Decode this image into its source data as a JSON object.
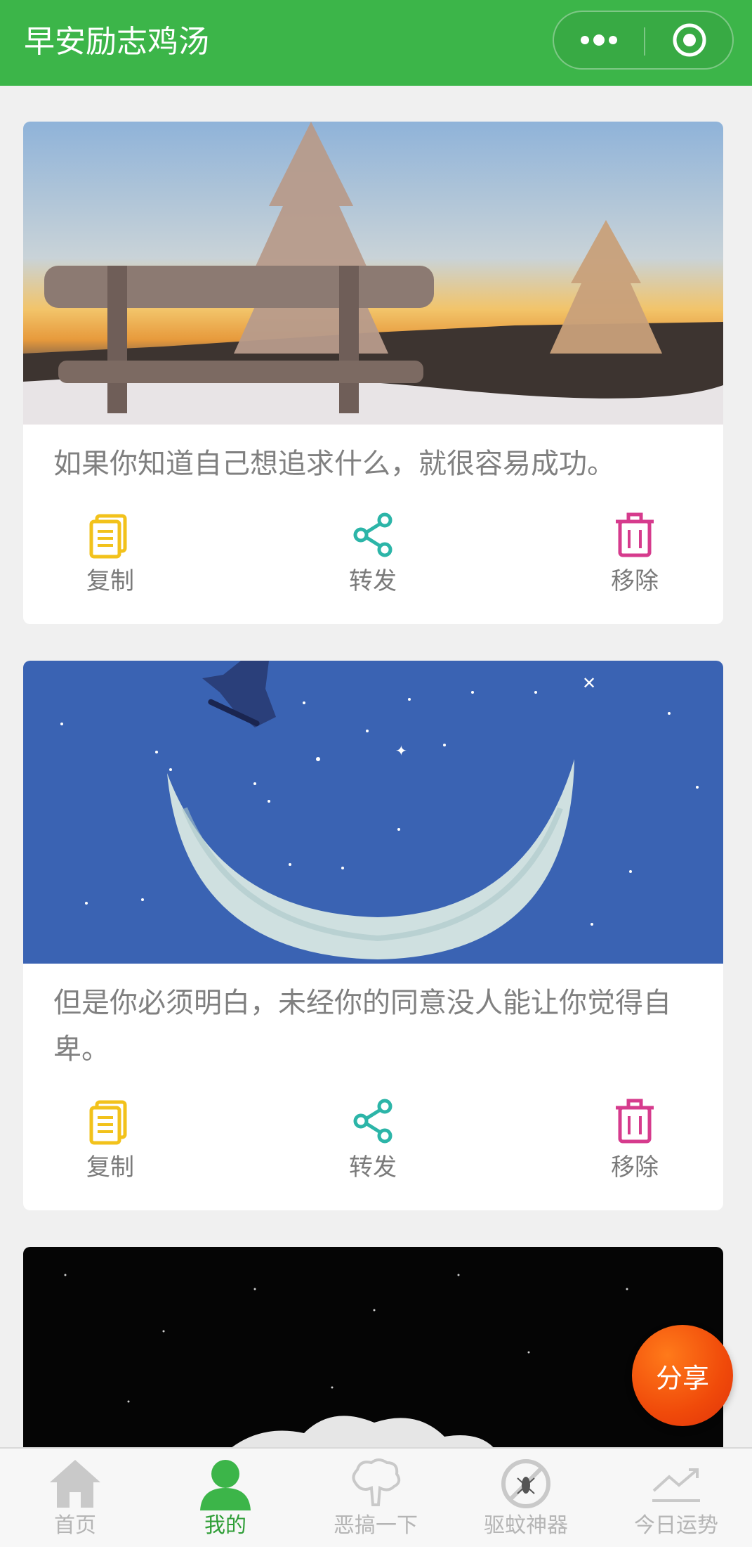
{
  "navbar": {
    "title": "早安励志鸡汤",
    "more_icon": "more-dots-icon",
    "close_icon": "target-close-icon",
    "bg_color": "#3cb549"
  },
  "cards": [
    {
      "image": "snowy-bench-sunset",
      "text": "如果你知道自己想追求什么，就很容易成功。",
      "actions": {
        "copy": "复制",
        "share": "转发",
        "remove": "移除"
      }
    },
    {
      "image": "skateboarder-moon",
      "text": "但是你必须明白，未经你的同意没人能让你觉得自卑。",
      "actions": {
        "copy": "复制",
        "share": "转发",
        "remove": "移除"
      }
    },
    {
      "image": "night-sky-clouds"
    }
  ],
  "share_fab": {
    "label": "分享"
  },
  "tabbar": {
    "items": [
      {
        "label": "首页",
        "icon": "home-icon"
      },
      {
        "label": "我的",
        "icon": "user-icon",
        "active": true
      },
      {
        "label": "恶搞一下",
        "icon": "tree-icon"
      },
      {
        "label": "驱蚊神器",
        "icon": "mosquito-icon"
      },
      {
        "label": "今日运势",
        "icon": "trend-icon"
      }
    ],
    "active_color": "#2f9e37"
  },
  "colors": {
    "copy": "#f2c21b",
    "share": "#2cb5a8",
    "remove": "#d63b8d"
  }
}
